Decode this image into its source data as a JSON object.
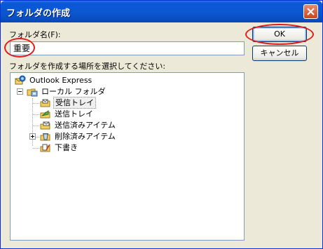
{
  "dialog": {
    "title": "フォルダの作成",
    "close_icon": "close-icon"
  },
  "form": {
    "folder_name_label": "フォルダ名(F):",
    "folder_name_value": "重要",
    "location_label": "フォルダを作成する場所を選択してください:"
  },
  "buttons": {
    "ok_label": "OK",
    "cancel_label": "キャンセル"
  },
  "tree": {
    "root": {
      "label": "Outlook Express",
      "icon": "outlook-express-icon"
    },
    "local_folders": {
      "label": "ローカル フォルダ",
      "icon": "local-folders-icon",
      "expanded": true
    },
    "items": [
      {
        "label": "受信トレイ",
        "icon": "inbox-icon",
        "selected": true
      },
      {
        "label": "送信トレイ",
        "icon": "outbox-icon",
        "selected": false
      },
      {
        "label": "送信済みアイテム",
        "icon": "sent-items-icon",
        "selected": false
      },
      {
        "label": "削除済みアイテム",
        "icon": "deleted-items-icon",
        "selected": false,
        "has_children": true
      },
      {
        "label": "下書き",
        "icon": "drafts-icon",
        "selected": false
      }
    ]
  },
  "colors": {
    "titlebar": "#0b57d0",
    "dialog_bg": "#ece9d8",
    "input_border": "#7f9db9",
    "annotation": "#e01b1b"
  }
}
